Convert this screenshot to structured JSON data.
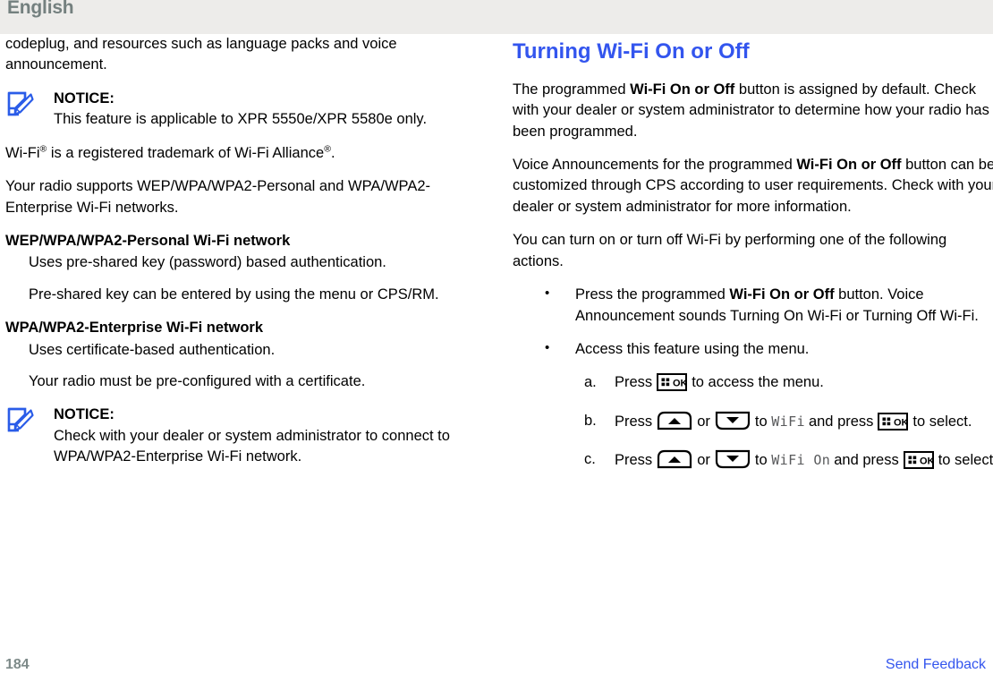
{
  "header": {
    "language": "English"
  },
  "left_column": {
    "intro_paragraph": "codeplug, and resources such as language packs and voice announcement.",
    "notice_1": {
      "icon": "note-pencil-icon",
      "title": "NOTICE:",
      "text": "This feature is applicable to XPR 5550e/XPR 5580e only."
    },
    "trademark": {
      "part1": "Wi-Fi",
      "sup1": "®",
      "part2": " is a registered trademark of Wi-Fi Alliance",
      "sup2": "®",
      "part3": "."
    },
    "support_paragraph": "Your radio supports WEP/WPA/WPA2-Personal and WPA/WPA2-Enterprise Wi-Fi networks.",
    "personal": {
      "term": "WEP/WPA/WPA2-Personal Wi-Fi network",
      "line1": "Uses pre-shared key (password) based authentication.",
      "line2": "Pre-shared key can be entered by using the menu or CPS/RM."
    },
    "enterprise": {
      "term": "WPA/WPA2-Enterprise Wi-Fi network",
      "line1": "Uses certificate-based authentication.",
      "line2": "Your radio must be pre-configured with a certificate."
    },
    "notice_2": {
      "icon": "note-pencil-icon",
      "title": "NOTICE:",
      "text": "Check with your dealer or system administrator to connect to WPA/WPA2-Enterprise Wi-Fi network."
    }
  },
  "right_column": {
    "heading": "Turning Wi-Fi On or Off",
    "para1": {
      "a": "The programmed ",
      "b": "Wi-Fi On or Off",
      "c": " button is assigned by default. Check with your dealer or system administrator to determine how your radio has been programmed."
    },
    "para2": {
      "a": "Voice Announcements for the programmed ",
      "b": "Wi-Fi On or Off",
      "c": " button can be customized through CPS according to user requirements. Check with your dealer or system administrator for more information."
    },
    "para3": "You can turn on or turn off Wi-Fi by performing one of the following actions.",
    "bullets": [
      {
        "a": "Press the programmed ",
        "b": "Wi-Fi On or Off",
        "c": " button. Voice Announcement sounds Turning On Wi-Fi or Turning Off Wi-Fi."
      },
      {
        "a": "Access this feature using the menu.",
        "b": "",
        "c": ""
      }
    ],
    "steps": [
      {
        "marker": "a.",
        "t1": "Press",
        "key1": "menu-ok-key",
        "t2": "to access the menu.",
        "display": "",
        "t3": "",
        "key2": "",
        "t4": ""
      },
      {
        "marker": "b.",
        "t1": "Press",
        "key1": "up-arrow-key",
        "or": "or",
        "key2": "down-arrow-key",
        "t2": "to",
        "display": "WiFi",
        "t3": "and press",
        "key3": "menu-ok-key",
        "t4": "to select."
      },
      {
        "marker": "c.",
        "t1": "Press",
        "key1": "up-arrow-key",
        "or": "or",
        "key2": "down-arrow-key",
        "t2": "to",
        "display": "WiFi On",
        "t3": "and press",
        "key3": "menu-ok-key",
        "t4": "to select."
      }
    ],
    "key_labels": {
      "ok": "OK"
    }
  },
  "footer": {
    "page_number": "184",
    "send_feedback": "Send Feedback"
  },
  "colors": {
    "header_band": "#edecea",
    "header_text": "#74807f",
    "heading_blue": "#3355ee",
    "notice_icon_blue": "#2a5ce8",
    "link_blue": "#3355ee",
    "page_number": "#7d8a89",
    "radio_display_text": "#58595b"
  }
}
